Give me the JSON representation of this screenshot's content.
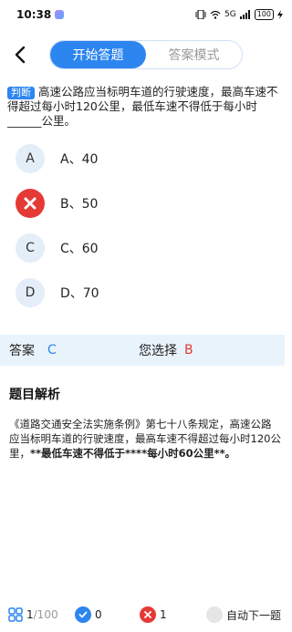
{
  "status_bar": {
    "time": "10:38",
    "network": "5G",
    "battery": "100"
  },
  "header": {
    "tabs": [
      {
        "label": "开始答题",
        "active": true
      },
      {
        "label": "答案模式",
        "active": false
      }
    ]
  },
  "question": {
    "tag": "判断",
    "text": "高速公路应当标明车道的行驶速度，最高车速不得超过每小时120公里，最低车速不得低于每小时______公里。"
  },
  "options": [
    {
      "letter": "A",
      "text": "A、40",
      "state": "normal"
    },
    {
      "letter": "B",
      "text": "B、50",
      "state": "wrong"
    },
    {
      "letter": "C",
      "text": "C、60",
      "state": "normal"
    },
    {
      "letter": "D",
      "text": "D、70",
      "state": "normal"
    }
  ],
  "answer_bar": {
    "answer_label": "答案",
    "answer_value": "C",
    "selected_label": "您选择",
    "selected_value": "B"
  },
  "analysis": {
    "title": "题目解析",
    "text_part1": "《道路交通安全法实施条例》第七十八条规定，高速公路应当标明车道的行驶速度，最高车速不得超过每小时120公里，",
    "text_part2": "**最低车速不得低于****每小时60公里**。"
  },
  "bottom_bar": {
    "progress": "1",
    "total": "/100",
    "correct_count": "0",
    "wrong_count": "1",
    "auto_next_label": "自动下一题"
  },
  "colors": {
    "accent": "#2d85f0",
    "wrong": "#e53935",
    "option_bg": "#e4eef8",
    "answer_bar_bg": "#e9f3fc"
  }
}
